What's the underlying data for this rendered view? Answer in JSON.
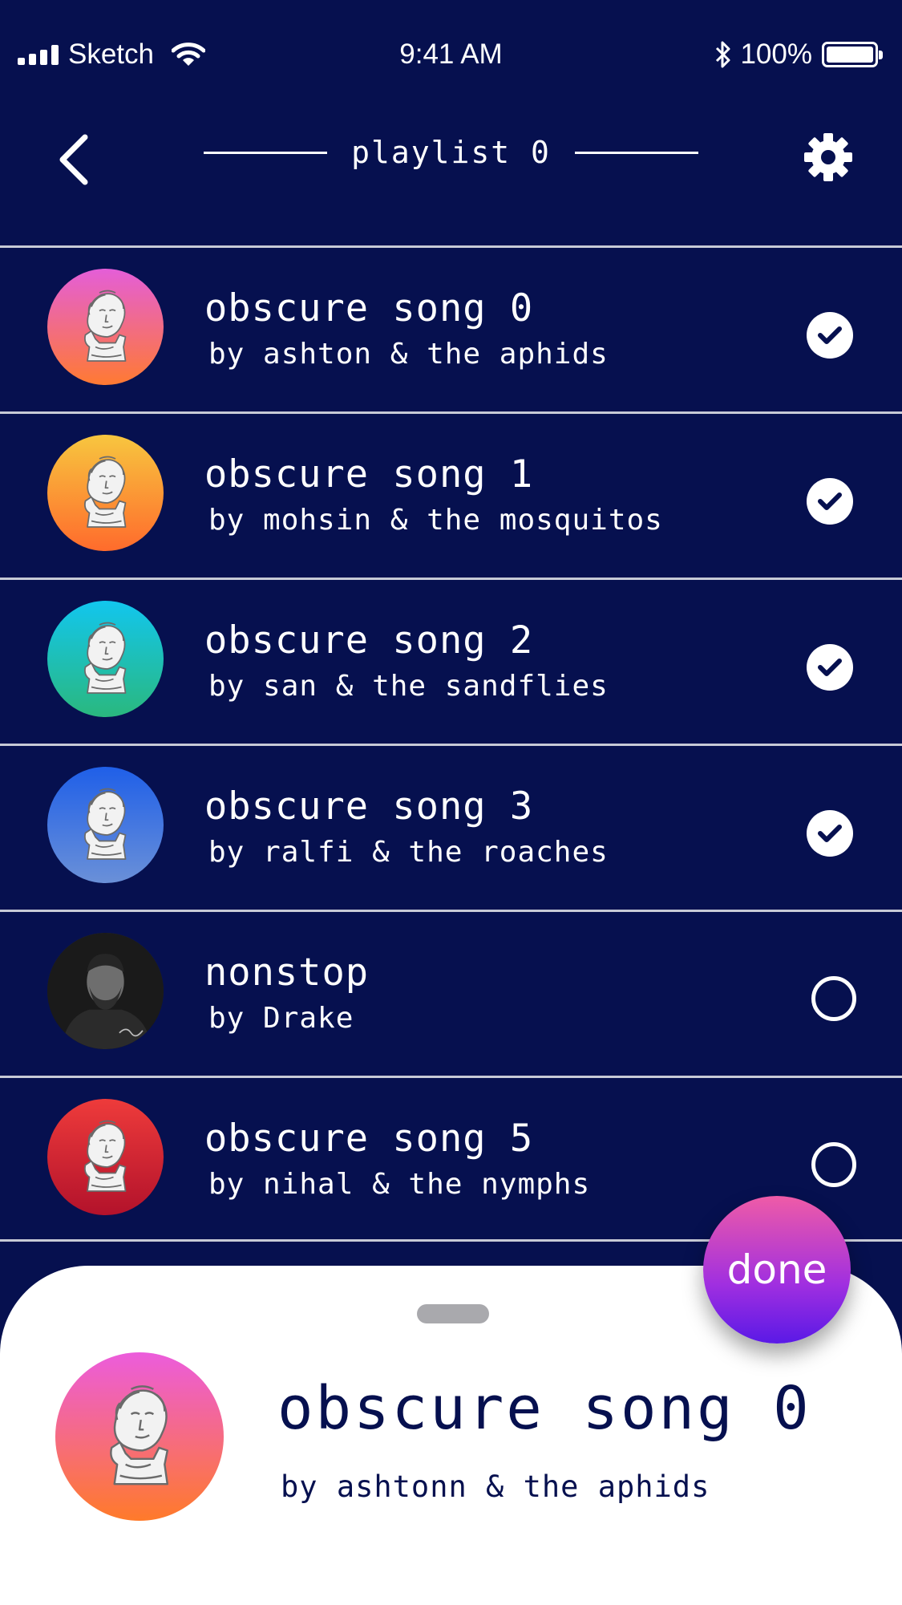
{
  "status_bar": {
    "carrier": "Sketch",
    "time": "9:41 AM",
    "battery": "100%"
  },
  "header": {
    "title": "playlist 0",
    "back_icon": "chevron-left-icon",
    "settings_icon": "gear-icon"
  },
  "songs": [
    {
      "title": "obscure song 0",
      "artist": "by ashton & the aphids",
      "selected": true,
      "art": "bust",
      "gradient": [
        "#e45ed8",
        "#ff7a32"
      ]
    },
    {
      "title": "obscure song 1",
      "artist": "by mohsin & the mosquitos",
      "selected": true,
      "art": "bust",
      "gradient": [
        "#f7c63f",
        "#ff6b2c"
      ]
    },
    {
      "title": "obscure song 2",
      "artist": "by san & the sandflies",
      "selected": true,
      "art": "bust",
      "gradient": [
        "#12c6ee",
        "#2ab87e"
      ]
    },
    {
      "title": "obscure song 3",
      "artist": "by ralfi & the roaches",
      "selected": true,
      "art": "bust",
      "gradient": [
        "#1f5fe8",
        "#6a90d8"
      ]
    },
    {
      "title": "nonstop",
      "artist": "by Drake",
      "selected": false,
      "art": "photo",
      "gradient": [
        "#3a3a3a",
        "#0e0e0e"
      ]
    },
    {
      "title": "obscure song 5",
      "artist": "by nihal & the nymphs",
      "selected": false,
      "art": "bust",
      "gradient": [
        "#ee3b3b",
        "#b3122b"
      ]
    }
  ],
  "now_playing": {
    "title": "obscure song 0",
    "artist": "by ashtonn & the aphids",
    "gradient": [
      "#ec5cdc",
      "#ff7a2a"
    ]
  },
  "done_label": "done",
  "colors": {
    "background": "#06104f",
    "sheet": "#ffffff",
    "divider": "#c7cad6",
    "done_top": "#ef5ba7",
    "done_bottom": "#5a19e6"
  }
}
